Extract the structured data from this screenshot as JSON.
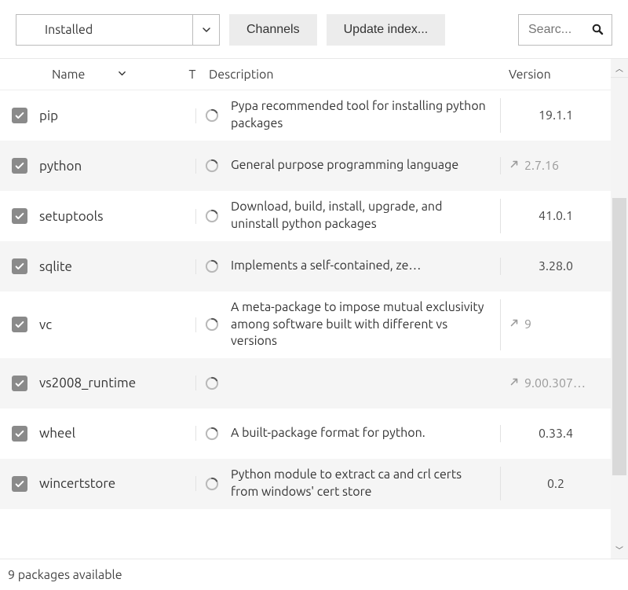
{
  "toolbar": {
    "filter_selected": "Installed",
    "channels_label": "Channels",
    "update_label": "Update index...",
    "search_placeholder": "Searc..."
  },
  "columns": {
    "name": "Name",
    "t": "T",
    "description": "Description",
    "version": "Version"
  },
  "packages": [
    {
      "name": "pip",
      "description": "Pypa recommended tool for installing python packages",
      "version": "19.1.1",
      "upgradable": false,
      "truncate": false
    },
    {
      "name": "python",
      "description": "General purpose programming language",
      "version": "2.7.16",
      "upgradable": true,
      "truncate": false
    },
    {
      "name": "setuptools",
      "description": "Download, build, install, upgrade, and uninstall python packages",
      "version": "41.0.1",
      "upgradable": false,
      "truncate": false
    },
    {
      "name": "sqlite",
      "description": "Implements a self-contained, ze…",
      "version": "3.28.0",
      "upgradable": false,
      "truncate": true
    },
    {
      "name": "vc",
      "description": "A meta-package to impose mutual exclusivity among software built with different vs versions",
      "version": "9",
      "upgradable": true,
      "truncate": false
    },
    {
      "name": "vs2008_runtime",
      "description": "",
      "version": "9.00.307…",
      "upgradable": true,
      "truncate": false
    },
    {
      "name": "wheel",
      "description": "A built-package format for python.",
      "version": "0.33.4",
      "upgradable": false,
      "truncate": true
    },
    {
      "name": "wincertstore",
      "description": "Python module to extract ca and crl certs from windows' cert store",
      "version": "0.2",
      "upgradable": false,
      "truncate": false
    }
  ],
  "footer": "9 packages available"
}
